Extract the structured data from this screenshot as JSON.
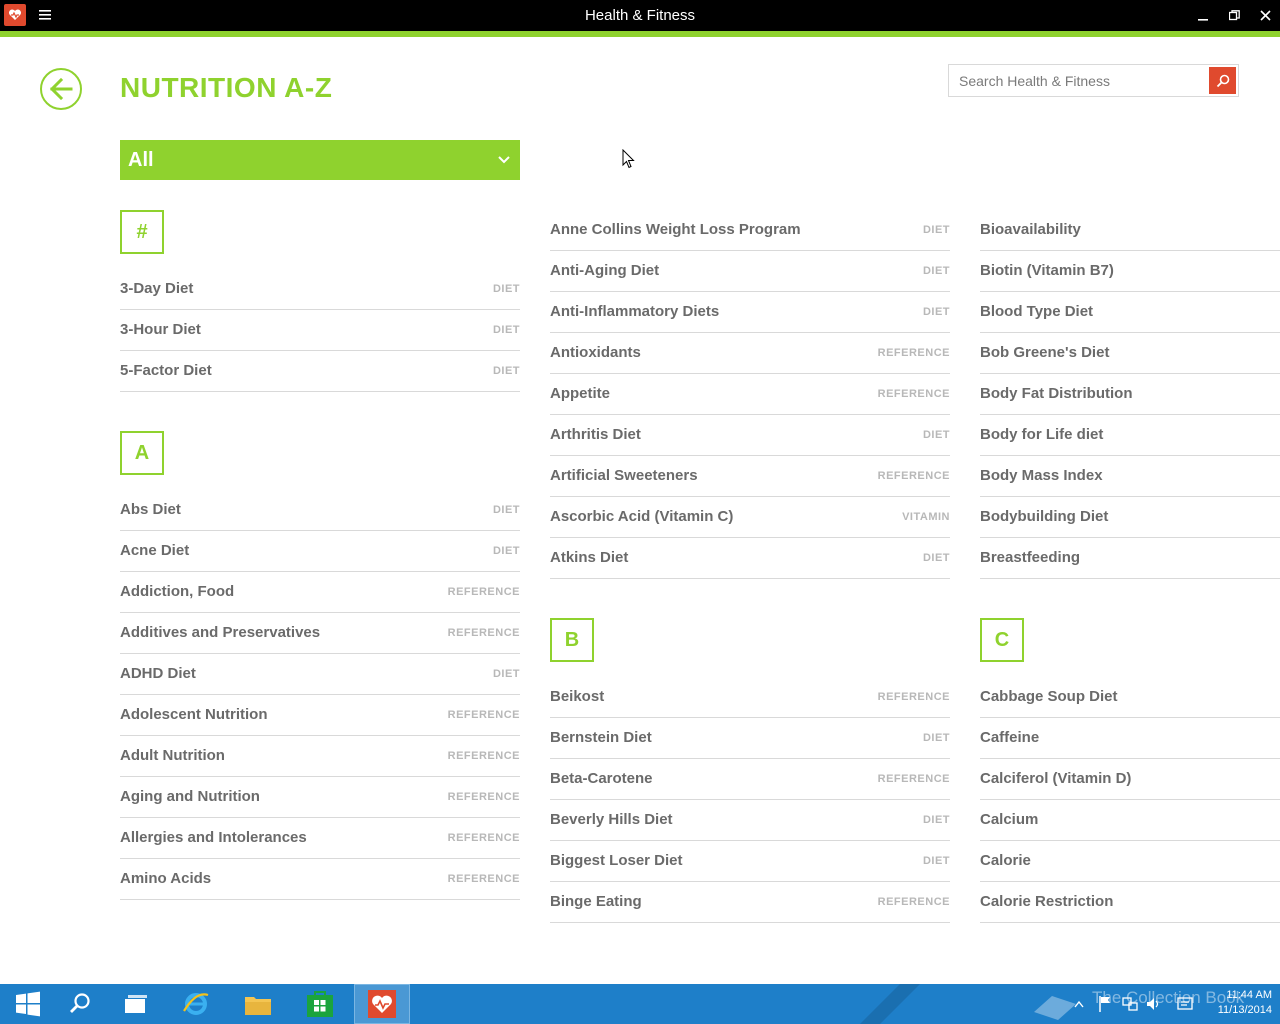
{
  "window": {
    "title": "Health & Fitness"
  },
  "page": {
    "title": "NUTRITION A-Z"
  },
  "search": {
    "placeholder": "Search Health & Fitness"
  },
  "filter": {
    "selected": "All"
  },
  "sections": {
    "hash": {
      "letter": "#",
      "items": [
        {
          "name": "3-Day Diet",
          "cat": "DIET"
        },
        {
          "name": "3-Hour Diet",
          "cat": "DIET"
        },
        {
          "name": "5-Factor Diet",
          "cat": "DIET"
        }
      ]
    },
    "a": {
      "letter": "A",
      "items": [
        {
          "name": "Abs Diet",
          "cat": "DIET"
        },
        {
          "name": "Acne Diet",
          "cat": "DIET"
        },
        {
          "name": "Addiction, Food",
          "cat": "REFERENCE"
        },
        {
          "name": "Additives and Preservatives",
          "cat": "REFERENCE"
        },
        {
          "name": "ADHD Diet",
          "cat": "DIET"
        },
        {
          "name": "Adolescent Nutrition",
          "cat": "REFERENCE"
        },
        {
          "name": "Adult Nutrition",
          "cat": "REFERENCE"
        },
        {
          "name": "Aging and Nutrition",
          "cat": "REFERENCE"
        },
        {
          "name": "Allergies and Intolerances",
          "cat": "REFERENCE"
        },
        {
          "name": "Amino Acids",
          "cat": "REFERENCE"
        }
      ]
    },
    "a2": {
      "items": [
        {
          "name": "Anne Collins Weight Loss Program",
          "cat": "DIET"
        },
        {
          "name": "Anti-Aging Diet",
          "cat": "DIET"
        },
        {
          "name": "Anti-Inflammatory Diets",
          "cat": "DIET"
        },
        {
          "name": "Antioxidants",
          "cat": "REFERENCE"
        },
        {
          "name": "Appetite",
          "cat": "REFERENCE"
        },
        {
          "name": "Arthritis Diet",
          "cat": "DIET"
        },
        {
          "name": "Artificial Sweeteners",
          "cat": "REFERENCE"
        },
        {
          "name": "Ascorbic Acid (Vitamin C)",
          "cat": "VITAMIN"
        },
        {
          "name": "Atkins Diet",
          "cat": "DIET"
        }
      ]
    },
    "b": {
      "letter": "B",
      "items": [
        {
          "name": "Beikost",
          "cat": "REFERENCE"
        },
        {
          "name": "Bernstein Diet",
          "cat": "DIET"
        },
        {
          "name": "Beta-Carotene",
          "cat": "REFERENCE"
        },
        {
          "name": "Beverly Hills Diet",
          "cat": "DIET"
        },
        {
          "name": "Biggest Loser Diet",
          "cat": "DIET"
        },
        {
          "name": "Binge Eating",
          "cat": "REFERENCE"
        }
      ]
    },
    "b2": {
      "items": [
        {
          "name": "Bioavailability"
        },
        {
          "name": "Biotin (Vitamin B7)"
        },
        {
          "name": "Blood Type Diet"
        },
        {
          "name": "Bob Greene's Diet"
        },
        {
          "name": "Body Fat Distribution"
        },
        {
          "name": "Body for Life diet"
        },
        {
          "name": "Body Mass Index"
        },
        {
          "name": "Bodybuilding Diet"
        },
        {
          "name": "Breastfeeding"
        }
      ]
    },
    "c": {
      "letter": "C",
      "items": [
        {
          "name": "Cabbage Soup Diet"
        },
        {
          "name": "Caffeine"
        },
        {
          "name": "Calciferol (Vitamin D)"
        },
        {
          "name": "Calcium"
        },
        {
          "name": "Calorie"
        },
        {
          "name": "Calorie Restriction"
        }
      ]
    }
  },
  "taskbar": {
    "time": "11:44 AM",
    "date": "11/13/2014",
    "watermark": "The Collection Book"
  },
  "colors": {
    "accent": "#8fd22e",
    "brand": "#e04a2e",
    "taskbar": "#1e7fc9"
  }
}
